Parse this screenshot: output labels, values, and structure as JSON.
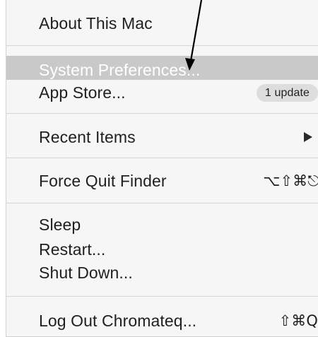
{
  "menu": {
    "about": "About This Mac",
    "system_preferences": "System Preferences...",
    "app_store": "App Store...",
    "app_store_badge": "1 update",
    "recent_items": "Recent Items",
    "force_quit": "Force Quit Finder",
    "force_quit_shortcut": "⌥⇧⌘⎋",
    "sleep": "Sleep",
    "restart": "Restart...",
    "shut_down": "Shut Down...",
    "log_out": "Log Out Chromateq...",
    "log_out_shortcut": "⇧⌘Q"
  },
  "colors": {
    "menu_background": "#f6f6f6",
    "highlight": "#c9c9c9",
    "badge_background": "#dddddd"
  },
  "icons": {
    "submenu": "triangle-right-icon",
    "annotation": "arrow-pointer-icon"
  }
}
